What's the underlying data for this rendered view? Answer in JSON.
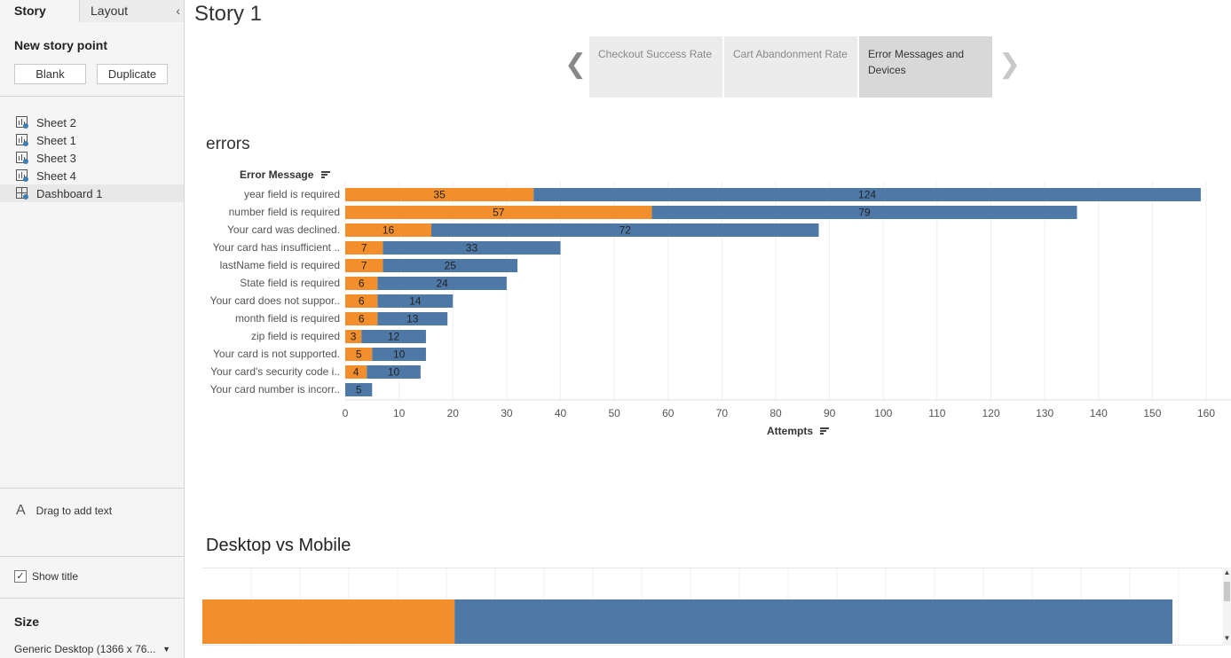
{
  "sidebar": {
    "tab_story": "Story",
    "tab_layout": "Layout",
    "new_story_point": "New story point",
    "btn_blank": "Blank",
    "btn_duplicate": "Duplicate",
    "sheets": [
      {
        "label": "Sheet 2",
        "icon": "worksheet-icon"
      },
      {
        "label": "Sheet 1",
        "icon": "worksheet-icon"
      },
      {
        "label": "Sheet 3",
        "icon": "worksheet-icon"
      },
      {
        "label": "Sheet 4",
        "icon": "worksheet-icon"
      },
      {
        "label": "Dashboard 1",
        "icon": "dashboard-icon"
      }
    ],
    "drag_text": "Drag to add text",
    "show_title": "Show title",
    "size_title": "Size",
    "size_value": "Generic Desktop (1366 x 76..."
  },
  "story": {
    "title": "Story 1",
    "points": [
      {
        "label": "Checkout Success Rate"
      },
      {
        "label": "Cart Abandonment Rate"
      },
      {
        "label": "Error Messages and Devices"
      }
    ]
  },
  "sheet_errors": {
    "title": "errors",
    "row_header": "Error Message",
    "x_title": "Attempts"
  },
  "sheet_devices": {
    "title": "Desktop vs Mobile"
  },
  "colors": {
    "orange": "#f28e2b",
    "blue": "#4e79a7"
  },
  "chart_data": [
    {
      "type": "bar",
      "orientation": "horizontal",
      "stacked": true,
      "categories": [
        "year field is required",
        "number field is required",
        "Your card was declined.",
        "Your card has insufficient ..",
        "lastName field is required",
        "State field is required",
        "Your card does not suppor..",
        "month field is required",
        "zip field is required",
        "Your card is not supported.",
        "Your card's security code i..",
        "Your card number is incorr.."
      ],
      "series": [
        {
          "values": [
            35,
            57,
            16,
            7,
            7,
            6,
            6,
            6,
            3,
            5,
            4,
            0
          ]
        },
        {
          "values": [
            124,
            79,
            72,
            33,
            25,
            24,
            14,
            13,
            12,
            10,
            10,
            5
          ]
        }
      ],
      "xlabel": "Attempts",
      "ylabel": "Error Message",
      "xlim": [
        0,
        160
      ],
      "xticks": [
        0,
        10,
        20,
        30,
        40,
        50,
        60,
        70,
        80,
        90,
        100,
        110,
        120,
        130,
        140,
        150,
        160
      ],
      "grid": true
    },
    {
      "type": "bar",
      "orientation": "horizontal",
      "stacked": true,
      "title": "Desktop vs Mobile",
      "categories": [
        ""
      ],
      "series": [
        {
          "values": [
            0.26
          ]
        },
        {
          "values": [
            0.74
          ]
        }
      ]
    }
  ]
}
